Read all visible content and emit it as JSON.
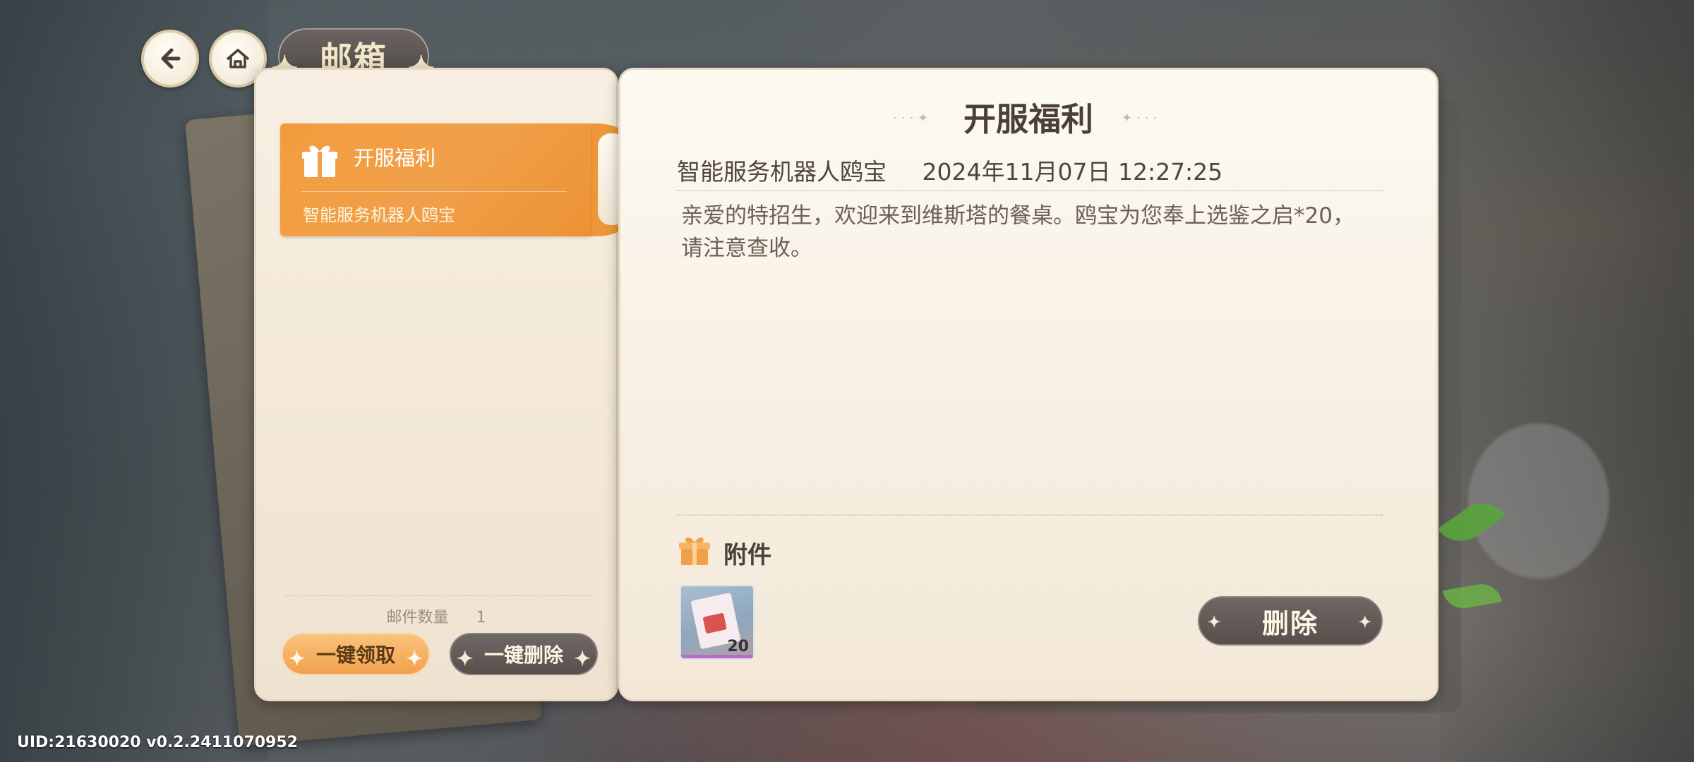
{
  "header": {
    "title": "邮箱",
    "back_icon": "arrow-left-icon",
    "home_icon": "home-icon"
  },
  "mail_list": {
    "items": [
      {
        "title": "开服福利",
        "sender": "智能服务机器人鸥宝",
        "icon": "gift-icon",
        "selected": true
      }
    ],
    "count_label": "邮件数量",
    "count_value": "1",
    "collect_all_label": "一键领取",
    "delete_all_label": "一键删除"
  },
  "mail_detail": {
    "title": "开服福利",
    "sender": "智能服务机器人鸥宝",
    "datetime": "2024年11月07日 12:27:25",
    "body": "亲爱的特招生，欢迎来到维斯塔的餐桌。鸥宝为您奉上选鉴之启*20，请注意查收。",
    "attachments_label": "附件",
    "attachments": [
      {
        "qty": "20",
        "icon": "ticket-card-icon"
      }
    ],
    "delete_label": "删除"
  },
  "footer": {
    "uid_text": "UID:21630020  v0.2.2411070952"
  },
  "colors": {
    "accent_orange": "#F09A3E",
    "dark_button": "#5F5855",
    "panel_bg": "#F8F1E6",
    "title_text": "#4B3F3A"
  }
}
